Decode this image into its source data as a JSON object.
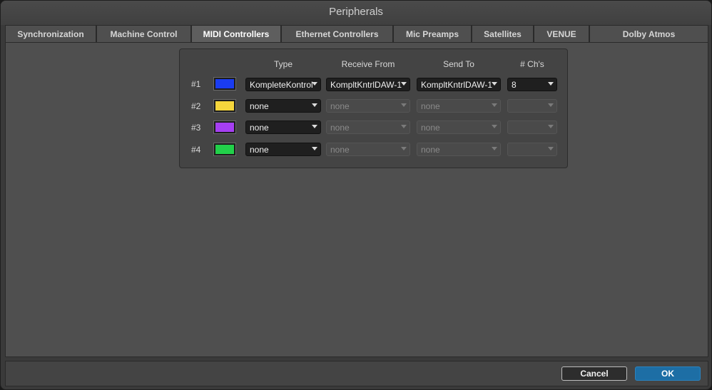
{
  "window": {
    "title": "Peripherals"
  },
  "tabs": [
    {
      "label": "Synchronization",
      "active": false
    },
    {
      "label": "Machine Control",
      "active": false
    },
    {
      "label": "MIDI Controllers",
      "active": true
    },
    {
      "label": "Ethernet Controllers",
      "active": false
    },
    {
      "label": "Mic Preamps",
      "active": false
    },
    {
      "label": "Satellites",
      "active": false
    },
    {
      "label": "VENUE",
      "active": false
    },
    {
      "label": "Dolby Atmos",
      "active": false
    }
  ],
  "midi": {
    "headers": {
      "type": "Type",
      "receive": "Receive From",
      "send": "Send To",
      "channels": "# Ch's"
    },
    "rows": [
      {
        "label": "#1",
        "color": "#1a3cf0",
        "type": "KompleteKontrol",
        "receive": "KompltKntrlDAW-1",
        "send": "KompltKntrlDAW-1",
        "channels": "8",
        "enabled": true
      },
      {
        "label": "#2",
        "color": "#f6d63c",
        "type": "none",
        "receive": "none",
        "send": "none",
        "channels": "",
        "enabled": false
      },
      {
        "label": "#3",
        "color": "#a63ff2",
        "type": "none",
        "receive": "none",
        "send": "none",
        "channels": "",
        "enabled": false
      },
      {
        "label": "#4",
        "color": "#22d04a",
        "type": "none",
        "receive": "none",
        "send": "none",
        "channels": "",
        "enabled": false
      }
    ]
  },
  "footer": {
    "cancel_label": "Cancel",
    "ok_label": "OK"
  }
}
